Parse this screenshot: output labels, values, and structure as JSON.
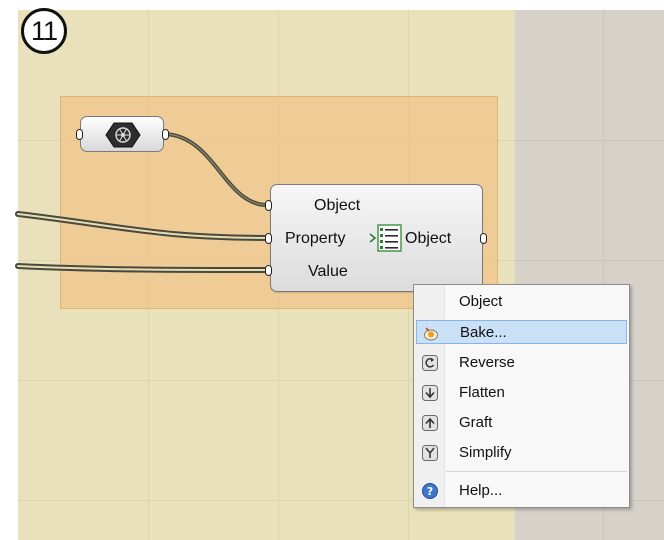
{
  "step_badge": "11",
  "colors": {
    "canvas": "#e9e1bb",
    "group": "#f4bc78",
    "grey_area": "#d7d2c9",
    "menu_highlight": "#c9e0f7"
  },
  "param_node": {
    "icon": "hexagon-mesh-icon"
  },
  "component": {
    "inputs": [
      "Object",
      "Property",
      "Value"
    ],
    "output": "Object",
    "icon": "property-list-icon"
  },
  "context_menu": {
    "header": "Object",
    "items": [
      {
        "label": "Bake...",
        "icon": "bake-icon",
        "selected": true
      },
      {
        "label": "Reverse",
        "icon": "reverse-icon"
      },
      {
        "label": "Flatten",
        "icon": "flatten-icon"
      },
      {
        "label": "Graft",
        "icon": "graft-icon"
      },
      {
        "label": "Simplify",
        "icon": "simplify-icon"
      }
    ],
    "help": {
      "label": "Help...",
      "icon": "help-icon"
    }
  }
}
